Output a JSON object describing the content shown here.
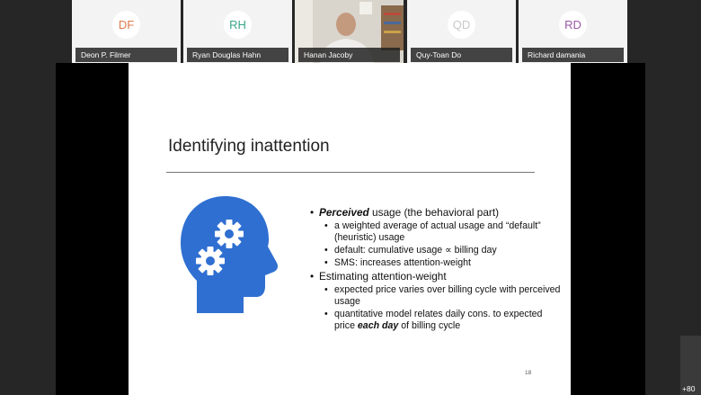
{
  "participants": [
    {
      "initials": "DF",
      "name": "Deon P. Filmer",
      "color": "#e07a4a"
    },
    {
      "initials": "RH",
      "name": "Ryan Douglas Hahn",
      "color": "#3aa58a"
    },
    {
      "name": "Hanan Jacoby",
      "video": true
    },
    {
      "initials": "QD",
      "name": "Quy-Toan Do",
      "color": "#c8c8c8"
    },
    {
      "initials": "RD",
      "name": "Richard damania",
      "color": "#9a5aa6"
    }
  ],
  "overflow_count": "+80",
  "slide": {
    "title": "Identifying inattention",
    "icon": "head-with-gears-icon",
    "icon_color": "#2f6fd1",
    "page_number": "18",
    "bullets": {
      "b1_lead": "Perceived",
      "b1_rest": " usage (the behavioral part)",
      "b1_sub1": "a weighted average of actual usage and “default” (heuristic) usage",
      "b1_sub2": "default: cumulative usage ∝ billing day",
      "b1_sub3": "SMS: increases attention-weight",
      "b2_text": "Estimating attention-weight",
      "b2_sub1": "expected price varies over billing cycle with perceived usage",
      "b2_sub2_start": "quantitative model relates daily cons. to expected price ",
      "b2_sub2_emph": "each day",
      "b2_sub2_end": " of billing cycle"
    }
  }
}
